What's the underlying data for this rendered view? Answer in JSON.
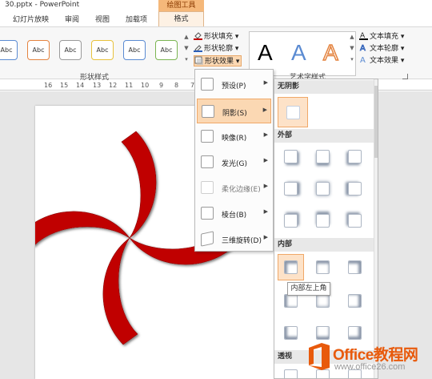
{
  "titlebar": {
    "title": "30.pptx - PowerPoint",
    "tool_group": "绘图工具"
  },
  "tabs": [
    {
      "label": "幻灯片放映"
    },
    {
      "label": "审阅"
    },
    {
      "label": "视图"
    },
    {
      "label": "加载项"
    }
  ],
  "active_tab": "格式",
  "ribbon": {
    "style_swatches": [
      "Abc",
      "Abc",
      "Abc",
      "Abc",
      "Abc",
      "Abc"
    ],
    "shape_fill_label": "形状填充",
    "shape_outline_label": "形状轮廓",
    "shape_effect_label": "形状效果",
    "wordart_letters": [
      "A",
      "A",
      "A"
    ],
    "text_fill_label": "文本填充",
    "text_outline_label": "文本轮廓",
    "text_effect_label": "文本效果",
    "group_shape_styles": "形状样式",
    "group_wordart_styles": "艺术字样式"
  },
  "ruler_numbers": [
    "16",
    "15",
    "14",
    "13",
    "12",
    "11",
    "10",
    "9",
    "8",
    "7",
    "6",
    "5",
    "4",
    "3",
    "2",
    "1"
  ],
  "effects_menu": [
    {
      "label": "预设(P)",
      "state": "normal"
    },
    {
      "label": "阴影(S)",
      "state": "active"
    },
    {
      "label": "映像(R)",
      "state": "normal"
    },
    {
      "label": "发光(G)",
      "state": "normal"
    },
    {
      "label": "柔化边缘(E)",
      "state": "normal"
    },
    {
      "label": "棱台(B)",
      "state": "normal"
    },
    {
      "label": "三维旋转(D)",
      "state": "normal"
    }
  ],
  "shadow_gallery": {
    "no_shadow_label": "无阴影",
    "outer_label": "外部",
    "inner_label": "内部",
    "perspective_label": "透视",
    "tooltip": "内部左上角"
  },
  "watermark": {
    "name": "Office教程网",
    "url": "www.office26.com"
  },
  "colors": {
    "accent": "#f0a868",
    "shape_red": "#c00000",
    "watermark_orange": "#e85a0c"
  }
}
